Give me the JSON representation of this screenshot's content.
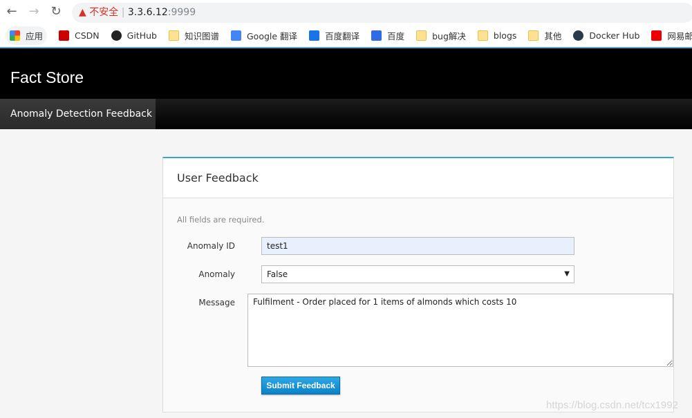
{
  "browser": {
    "security_label": "不安全",
    "url_host": "3.3.6.12",
    "url_port": ":9999",
    "bookmarks": [
      {
        "label": "应用",
        "icon": "apps-icon"
      },
      {
        "label": "CSDN",
        "icon": "csdn-icon"
      },
      {
        "label": "GitHub",
        "icon": "github-icon"
      },
      {
        "label": "知识图谱",
        "icon": "folder-icon"
      },
      {
        "label": "Google 翻译",
        "icon": "google-translate-icon"
      },
      {
        "label": "百度翻译",
        "icon": "baidu-translate-icon"
      },
      {
        "label": "百度",
        "icon": "baidu-icon"
      },
      {
        "label": "bug解决",
        "icon": "folder-icon"
      },
      {
        "label": "blogs",
        "icon": "folder-icon"
      },
      {
        "label": "其他",
        "icon": "folder-icon"
      },
      {
        "label": "Docker Hub",
        "icon": "docker-icon"
      },
      {
        "label": "网易邮箱",
        "icon": "netease-mail-icon"
      }
    ]
  },
  "app": {
    "brand": "Fact Store",
    "nav_tab": "Anomaly Detection Feedback"
  },
  "panel": {
    "title": "User Feedback",
    "required_note": "All fields are required.",
    "fields": {
      "anomaly_id_label": "Anomaly ID",
      "anomaly_id_value": "test1",
      "anomaly_label": "Anomaly",
      "anomaly_value": "False",
      "message_label": "Message",
      "message_value": "Fulfilment - Order placed for 1 items of almonds which costs 10"
    },
    "submit_label": "Submit Feedback"
  },
  "watermark": "https://blog.csdn.net/tcx1992",
  "colors": {
    "accent": "#39a3dc",
    "button": "#0a82c8",
    "autofill": "#e8f0fe"
  }
}
